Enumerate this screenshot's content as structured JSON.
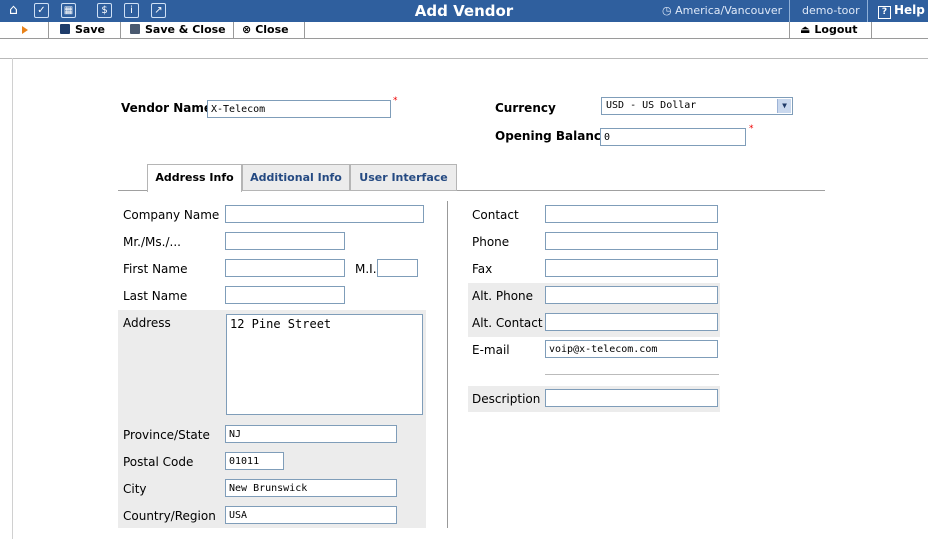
{
  "header": {
    "title": "Add Vendor",
    "timezone": "America/Vancouver",
    "user": "demo-toor",
    "help_label": "Help"
  },
  "toolbar": {
    "save_label": "Save",
    "save_close_label": "Save & Close",
    "close_label": "Close",
    "logout_label": "Logout"
  },
  "vendor": {
    "name_label": "Vendor Name",
    "name_value": "X-Telecom",
    "currency_label": "Currency",
    "currency_value": "USD - US Dollar",
    "opening_balance_label": "Opening Balance",
    "opening_balance_value": "0"
  },
  "tabs": {
    "address_info": "Address Info",
    "additional_info": "Additional Info",
    "user_interface": "User Interface"
  },
  "address": {
    "company_name_label": "Company Name",
    "company_name_value": "",
    "salutation_label": "Mr./Ms./...",
    "salutation_value": "",
    "first_name_label": "First Name",
    "first_name_value": "",
    "mi_label": "M.I.",
    "mi_value": "",
    "last_name_label": "Last Name",
    "last_name_value": "",
    "address_label": "Address",
    "address_value": "12 Pine Street",
    "province_label": "Province/State",
    "province_value": "NJ",
    "postal_label": "Postal Code",
    "postal_value": "01011",
    "city_label": "City",
    "city_value": "New Brunswick",
    "country_label": "Country/Region",
    "country_value": "USA"
  },
  "contact": {
    "contact_label": "Contact",
    "contact_value": "",
    "phone_label": "Phone",
    "phone_value": "",
    "fax_label": "Fax",
    "fax_value": "",
    "alt_phone_label": "Alt. Phone",
    "alt_phone_value": "",
    "alt_contact_label": "Alt. Contact",
    "alt_contact_value": "",
    "email_label": "E-mail",
    "email_value": "voip@x-telecom.com",
    "description_label": "Description",
    "description_value": ""
  },
  "colors": {
    "header_bg": "#2f5f9e",
    "tab_text": "#254a82",
    "required": "#e00000"
  }
}
